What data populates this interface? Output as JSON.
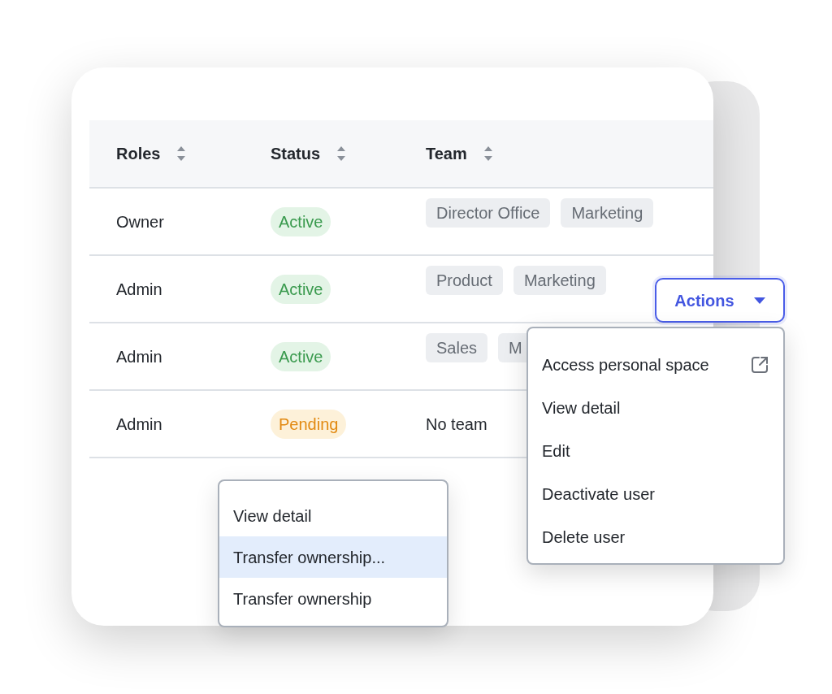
{
  "table": {
    "columns": [
      {
        "label": "Roles"
      },
      {
        "label": "Status"
      },
      {
        "label": "Team"
      }
    ],
    "rows": [
      {
        "role": "Owner",
        "status": {
          "label": "Active",
          "kind": "active"
        },
        "teams": [
          "Director Office",
          "Marketing"
        ]
      },
      {
        "role": "Admin",
        "status": {
          "label": "Active",
          "kind": "active"
        },
        "teams": [
          "Product",
          "Marketing"
        ]
      },
      {
        "role": "Admin",
        "status": {
          "label": "Active",
          "kind": "active"
        },
        "teams": [
          "Sales",
          "M"
        ]
      },
      {
        "role": "Admin",
        "status": {
          "label": "Pending",
          "kind": "pending"
        },
        "team_text": "No team"
      }
    ]
  },
  "actions_button": {
    "label": "Actions"
  },
  "actions_menu": [
    {
      "label": "Access personal space",
      "kind": "external",
      "selected": false
    },
    {
      "label": "View detail",
      "kind": "plain",
      "selected": false
    },
    {
      "label": "Edit",
      "kind": "plain",
      "selected": false
    },
    {
      "label": "Deactivate user",
      "kind": "plain",
      "selected": false
    },
    {
      "label": "Delete user",
      "kind": "plain",
      "selected": false
    }
  ],
  "row_menu": [
    {
      "label": "View detail",
      "selected": false
    },
    {
      "label": "Transfer ownership...",
      "selected": true
    },
    {
      "label": "Transfer ownership",
      "selected": false
    }
  ]
}
